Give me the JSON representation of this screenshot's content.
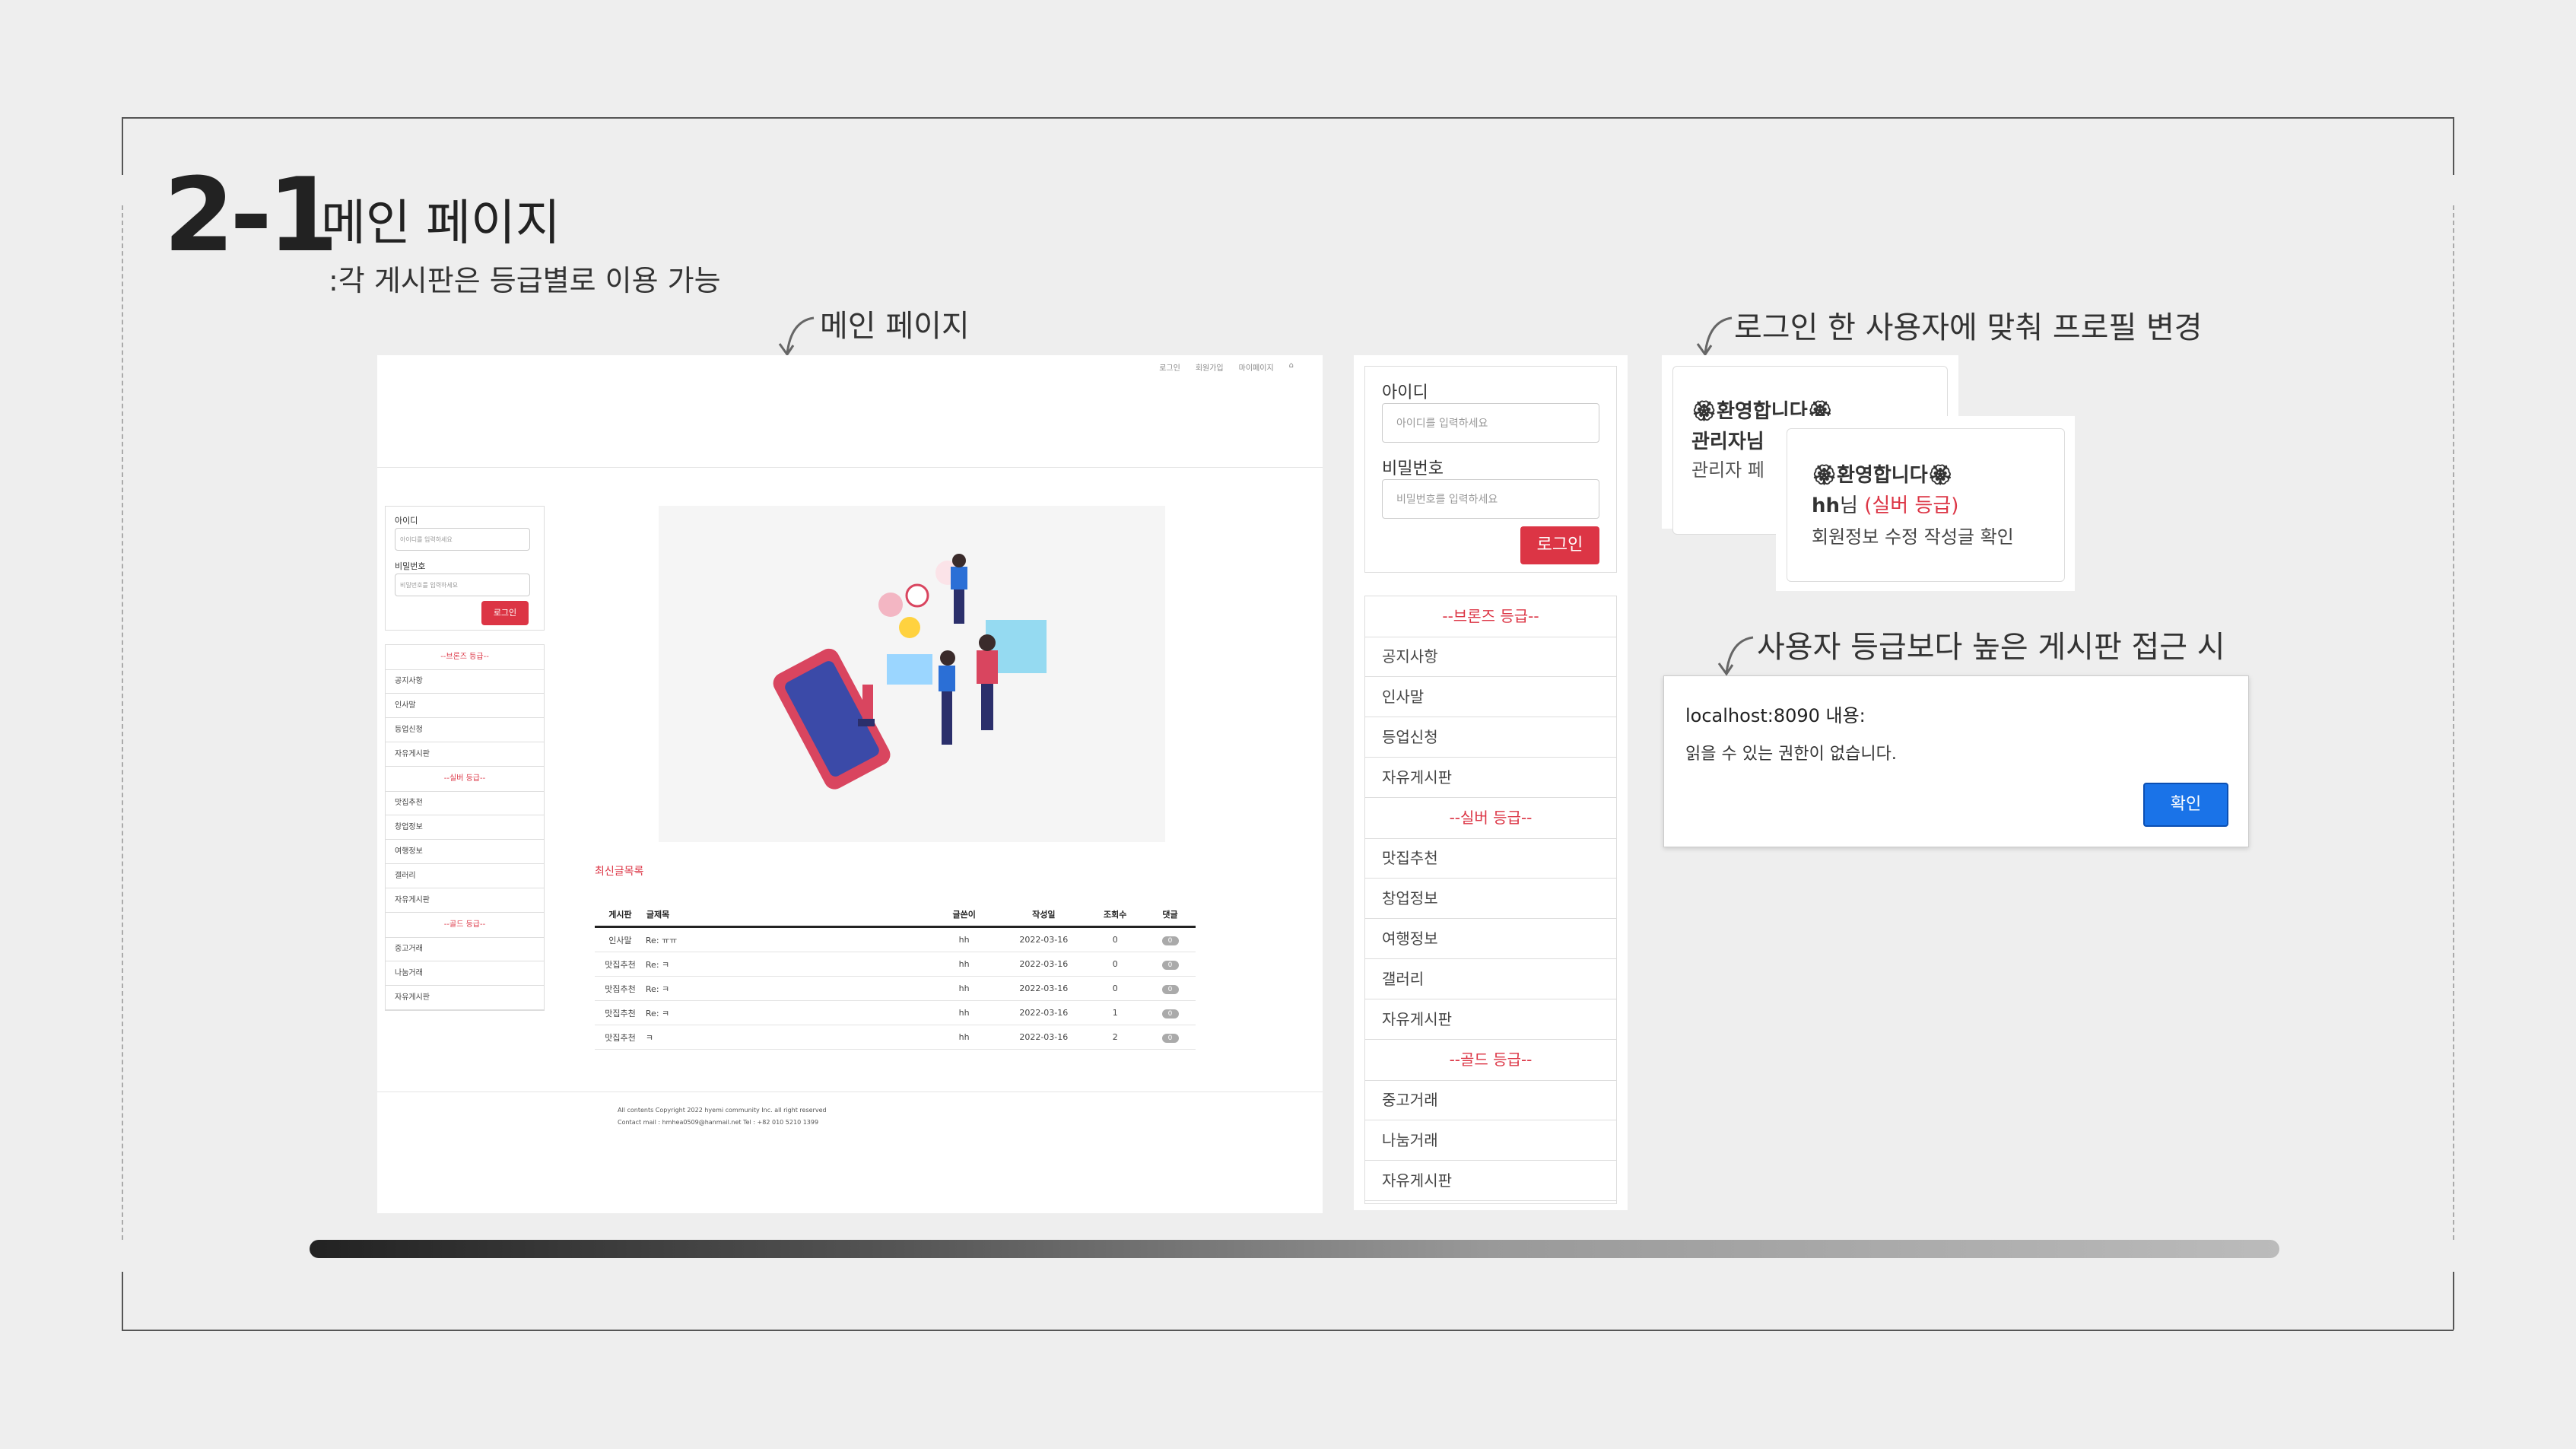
{
  "section": {
    "number": "2-1",
    "title": "메인 페이지",
    "subtitle": ":각 게시판은 등급별로 이용 가능"
  },
  "captions": {
    "main_page": "메인 페이지",
    "profile_change": "로그인 한 사용자에 맞춰 프로필 변경",
    "access_denied": "사용자 등급보다 높은 게시판 접근 시"
  },
  "main_screenshot": {
    "top_nav": [
      "로그인",
      "회원가입",
      "마이페이지",
      "⌂"
    ],
    "login": {
      "id_label": "아이디",
      "id_placeholder": "아이디를 입력하세요",
      "pw_label": "비밀번호",
      "pw_placeholder": "비밀번호를 입력하세요",
      "button": "로그인"
    },
    "menu": {
      "bronze": "--브론즈 등급--",
      "bronze_items": [
        "공지사항",
        "인사말",
        "등업신청",
        "자유게시판"
      ],
      "silver": "--실버 등급--",
      "silver_items": [
        "맛집추천",
        "창업정보",
        "여행정보",
        "갤러리",
        "자유게시판"
      ],
      "gold": "--골드 등급--",
      "gold_items": [
        "중고거래",
        "나눔거래",
        "자유게시판"
      ]
    },
    "recent": {
      "title": "최신글목록",
      "headers": [
        "게시판",
        "글제목",
        "글쓴이",
        "작성일",
        "조회수",
        "댓글"
      ],
      "rows": [
        [
          "인사말",
          "Re: ㅠㅠ",
          "hh",
          "2022-03-16",
          "0",
          "0"
        ],
        [
          "맛집추천",
          "Re: ㅋ",
          "hh",
          "2022-03-16",
          "0",
          "0"
        ],
        [
          "맛집추천",
          "Re: ㅋ",
          "hh",
          "2022-03-16",
          "0",
          "0"
        ],
        [
          "맛집추천",
          "Re: ㅋ",
          "hh",
          "2022-03-16",
          "1",
          "0"
        ],
        [
          "맛집추천",
          "ㅋ",
          "hh",
          "2022-03-16",
          "2",
          "0"
        ]
      ]
    },
    "footer": {
      "line1": "All contents Copyright 2022 hyemi community Inc. all right reserved",
      "line2": "Contact mail : hmhea0509@hanmail.net Tel : +82 010 5210 1399"
    }
  },
  "zoomed_sidebar": {
    "id_label": "아이디",
    "id_placeholder": "아이디를 입력하세요",
    "pw_label": "비밀번호",
    "pw_placeholder": "비밀번호를 입력하세요",
    "button": "로그인",
    "bronze": "--브론즈 등급--",
    "bronze_items": [
      "공지사항",
      "인사말",
      "등업신청",
      "자유게시판"
    ],
    "silver": "--실버 등급--",
    "silver_items": [
      "맛집추천",
      "창업정보",
      "여행정보",
      "갤러리",
      "자유게시판"
    ],
    "gold": "--골드 등급--",
    "gold_items": [
      "중고거래",
      "나눔거래",
      "자유게시판"
    ]
  },
  "welcome_admin": {
    "greeting": "🏵환영합니다🏵",
    "user": "관리자님",
    "links": "관리자 페"
  },
  "welcome_user": {
    "greeting": "🏵환영합니다🏵",
    "user": "hh",
    "suffix": "님",
    "grade": "(실버 등급)",
    "links": "회원정보 수정 작성글 확인"
  },
  "alert": {
    "title": "localhost:8090 내용:",
    "message": "읽을 수 있는 권한이 없습니다.",
    "button": "확인"
  },
  "colors": {
    "accent_red": "#dc3545",
    "alert_blue": "#1a73e8"
  }
}
